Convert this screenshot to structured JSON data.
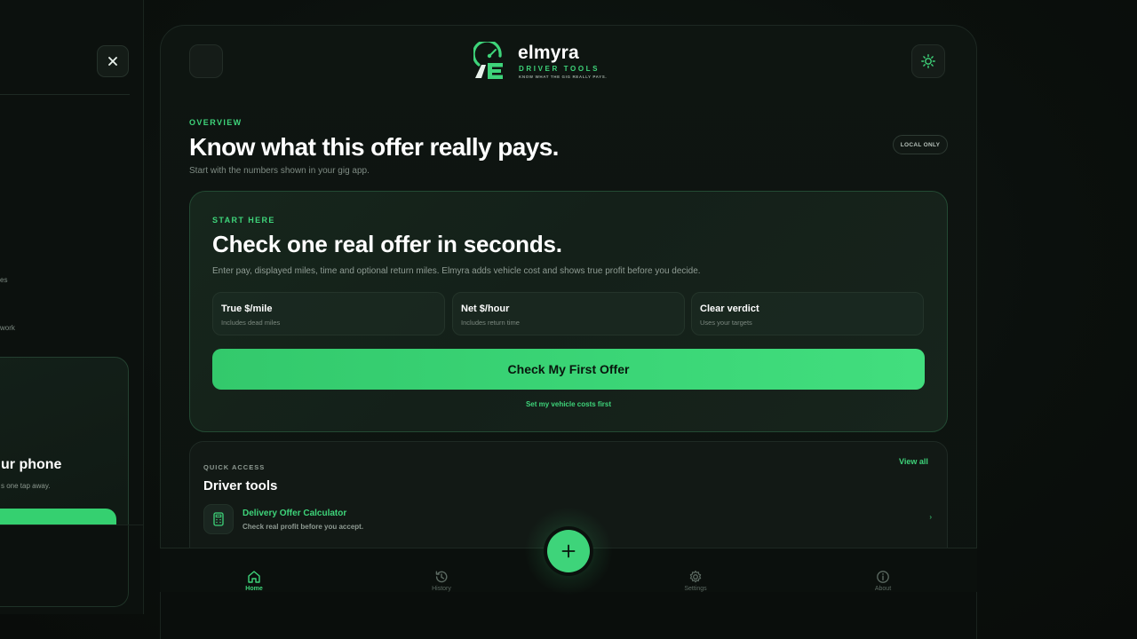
{
  "drawer": {
    "close_icon": "close-icon",
    "fragment_1": "es",
    "fragment_2": "work",
    "card_title": "ur phone",
    "card_subtitle": "s one tap away."
  },
  "header": {
    "menu_icon": "menu-icon",
    "brand_name": "elmyra",
    "brand_subtitle": "DRIVER TOOLS",
    "brand_tagline": "KNOW WHAT THE GIG REALLY PAYS.",
    "theme_icon": "sun-icon"
  },
  "overview": {
    "eyebrow": "OVERVIEW",
    "title": "Know what this offer really pays.",
    "subtitle": "Start with the numbers shown in your gig app.",
    "badge": "LOCAL ONLY"
  },
  "hero": {
    "eyebrow": "START HERE",
    "title": "Check one real offer in seconds.",
    "description": "Enter pay, displayed miles, time and optional return miles. Elmyra adds vehicle cost and shows true profit before you decide.",
    "metrics": [
      {
        "title": "True $/mile",
        "subtitle": "Includes dead miles"
      },
      {
        "title": "Net $/hour",
        "subtitle": "Includes return time"
      },
      {
        "title": "Clear verdict",
        "subtitle": "Uses your targets"
      }
    ],
    "cta_label": "Check My First Offer",
    "secondary_label": "Set my vehicle costs first"
  },
  "quick_access": {
    "eyebrow": "QUICK ACCESS",
    "title": "Driver tools",
    "view_all": "View all",
    "tools": [
      {
        "name": "Delivery Offer Calculator",
        "subtitle": "Check real profit before you accept.",
        "icon": "calculator-icon"
      }
    ]
  },
  "tabbar": {
    "tabs": [
      {
        "label": "Home",
        "icon": "home-icon",
        "active": true
      },
      {
        "label": "History",
        "icon": "history-icon",
        "active": false
      },
      {
        "label": "Settings",
        "icon": "gear-icon",
        "active": false
      },
      {
        "label": "About",
        "icon": "info-icon",
        "active": false
      }
    ],
    "fab_icon": "plus-icon"
  },
  "colors": {
    "accent": "#3ed47a",
    "background": "#0b100d",
    "card": "#121915"
  }
}
